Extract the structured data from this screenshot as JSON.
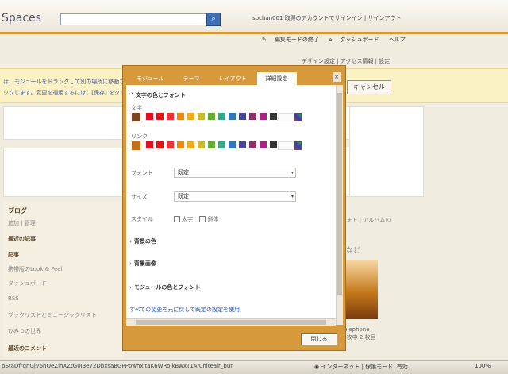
{
  "header": {
    "logo": "Spaces",
    "user_line": "spchan001  取得のアカウントでサインイン  |  サインアウト",
    "search_icon": "search-icon"
  },
  "toolbar": {
    "edit_end": "編集モードの終了",
    "dashboard": "ダッシュボード",
    "help": "ヘルプ"
  },
  "design_line": "デザイン設定 | アクセス情報 | 設定",
  "banner": {
    "line1": "は、モジュールをドラッグして別の場所に移動させ",
    "line2": "ックします。変更を適用するには、[保存] をクリッ",
    "cancel": "キャンセル"
  },
  "sidebar": {
    "blog": "ブログ",
    "blog_sub": "追加 | 管理",
    "recent": "最近の記事",
    "post": "記事",
    "item1": "携帯版のLook & Feel",
    "item2": "ダッシュボード",
    "item3": "RSS",
    "item4": "ブックリストとミュージックリスト",
    "item5": "ひみつの世界",
    "comments": "最近のコメント"
  },
  "right": {
    "links": "| フォト | アルバムの",
    "nado": "など",
    "cap1": "Telephone",
    "cap2": "1 枚中 2 枚目"
  },
  "dialog": {
    "tabs": [
      "モジュール",
      "テーマ",
      "レイアウト",
      "詳細設定"
    ],
    "active_tab": 3,
    "section_title": "文字の色とフォント",
    "text_label": "文字",
    "link_label": "リンク",
    "font_label": "フォント",
    "font_value": "既定",
    "size_label": "サイズ",
    "size_value": "既定",
    "style_label": "スタイル",
    "bold": "太字",
    "italic": "斜体",
    "bg_color": "背景の色",
    "bg_image": "背景画像",
    "module_colors": "モジュールの色とフォント",
    "reset": "すべての変更を元に戻して既定の設定を使用",
    "close": "閉じる",
    "text_current": "#7a4322",
    "link_current": "#c4701a",
    "palette": [
      "#d12",
      "#e11",
      "#e33",
      "#e81",
      "#ea2",
      "#cb2",
      "#6a3",
      "#3a8",
      "#37b",
      "#449",
      "#836",
      "#a28",
      "#333"
    ]
  },
  "status": {
    "url": "pStaDfrqnGjV6hQeZlhXZtG0I3e72DbxsaBGPPbwhxltaK6WRojkBwxT1A/uniteair_bur",
    "zone": "インターネット | 保護モード: 有効",
    "zoom": "100%"
  }
}
